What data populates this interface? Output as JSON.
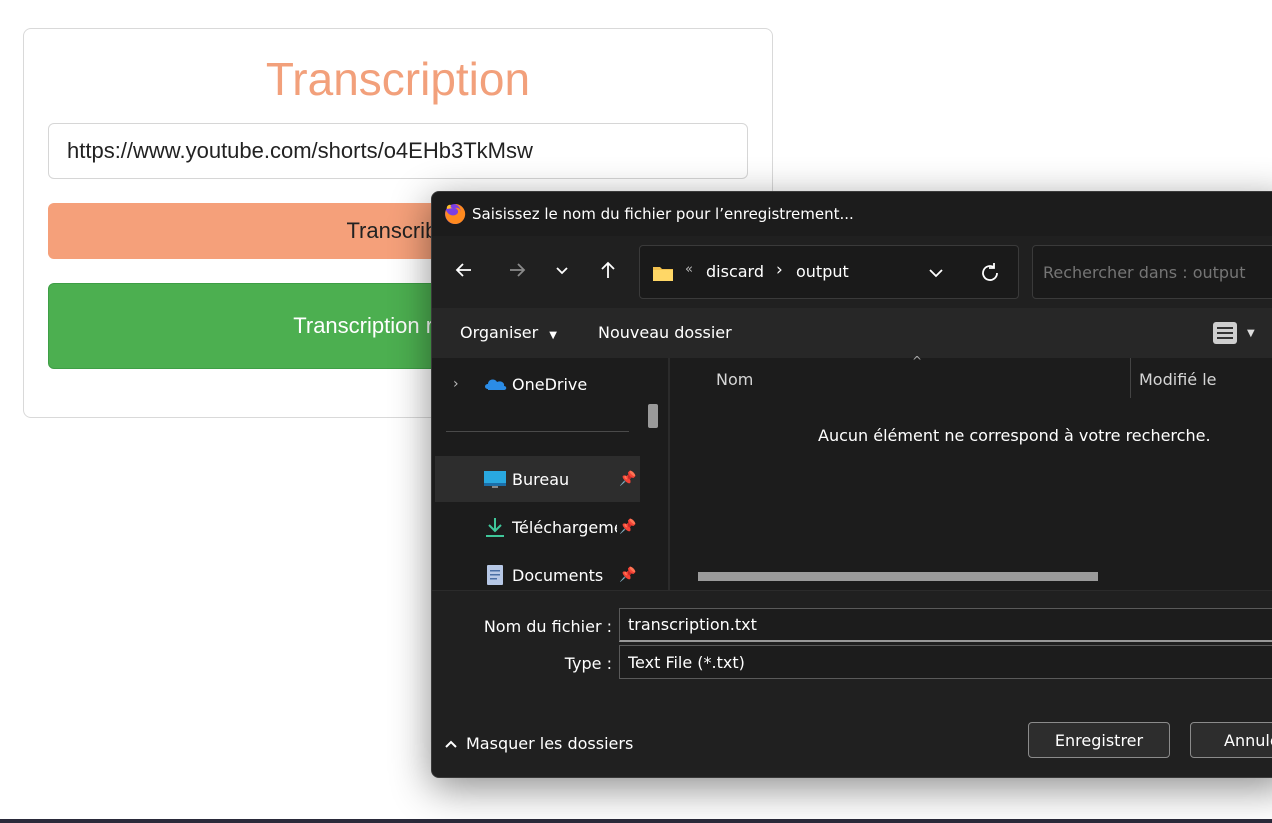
{
  "page": {
    "title": "Transcription",
    "url_value": "https://www.youtube.com/shorts/o4EHb3TkMsw",
    "transcribe_button": "Transcribe",
    "transcription_button": "Transcription réalisée"
  },
  "dialog": {
    "title": "Saisissez le nom du fichier pour l’enregistrement...",
    "breadcrumb_overflow": "«",
    "breadcrumb": [
      "discard",
      "output"
    ],
    "search_placeholder": "Rechercher dans : output",
    "organize_label": "Organiser",
    "new_folder_label": "Nouveau dossier",
    "nav_items": [
      {
        "label": "OneDrive",
        "icon": "onedrive-icon"
      },
      {
        "label": "Bureau",
        "icon": "desktop-icon"
      },
      {
        "label": "Téléchargements",
        "icon": "download-icon"
      },
      {
        "label": "Documents",
        "icon": "documents-icon"
      }
    ],
    "columns": {
      "name": "Nom",
      "modified": "Modifié le"
    },
    "empty_message": "Aucun élément ne correspond à votre recherche.",
    "filename_label": "Nom du fichier :",
    "filename_value": "transcription.txt",
    "type_label": "Type :",
    "type_value": "Text File (*.txt)",
    "hide_folders_label": "Masquer les dossiers",
    "save_button": "Enregistrer",
    "cancel_button": "Annuler"
  },
  "colors": {
    "title_orange": "#f2a07b",
    "button_orange": "#f5a07a",
    "button_green": "#4caf50",
    "dialog_bg": "#202020"
  }
}
